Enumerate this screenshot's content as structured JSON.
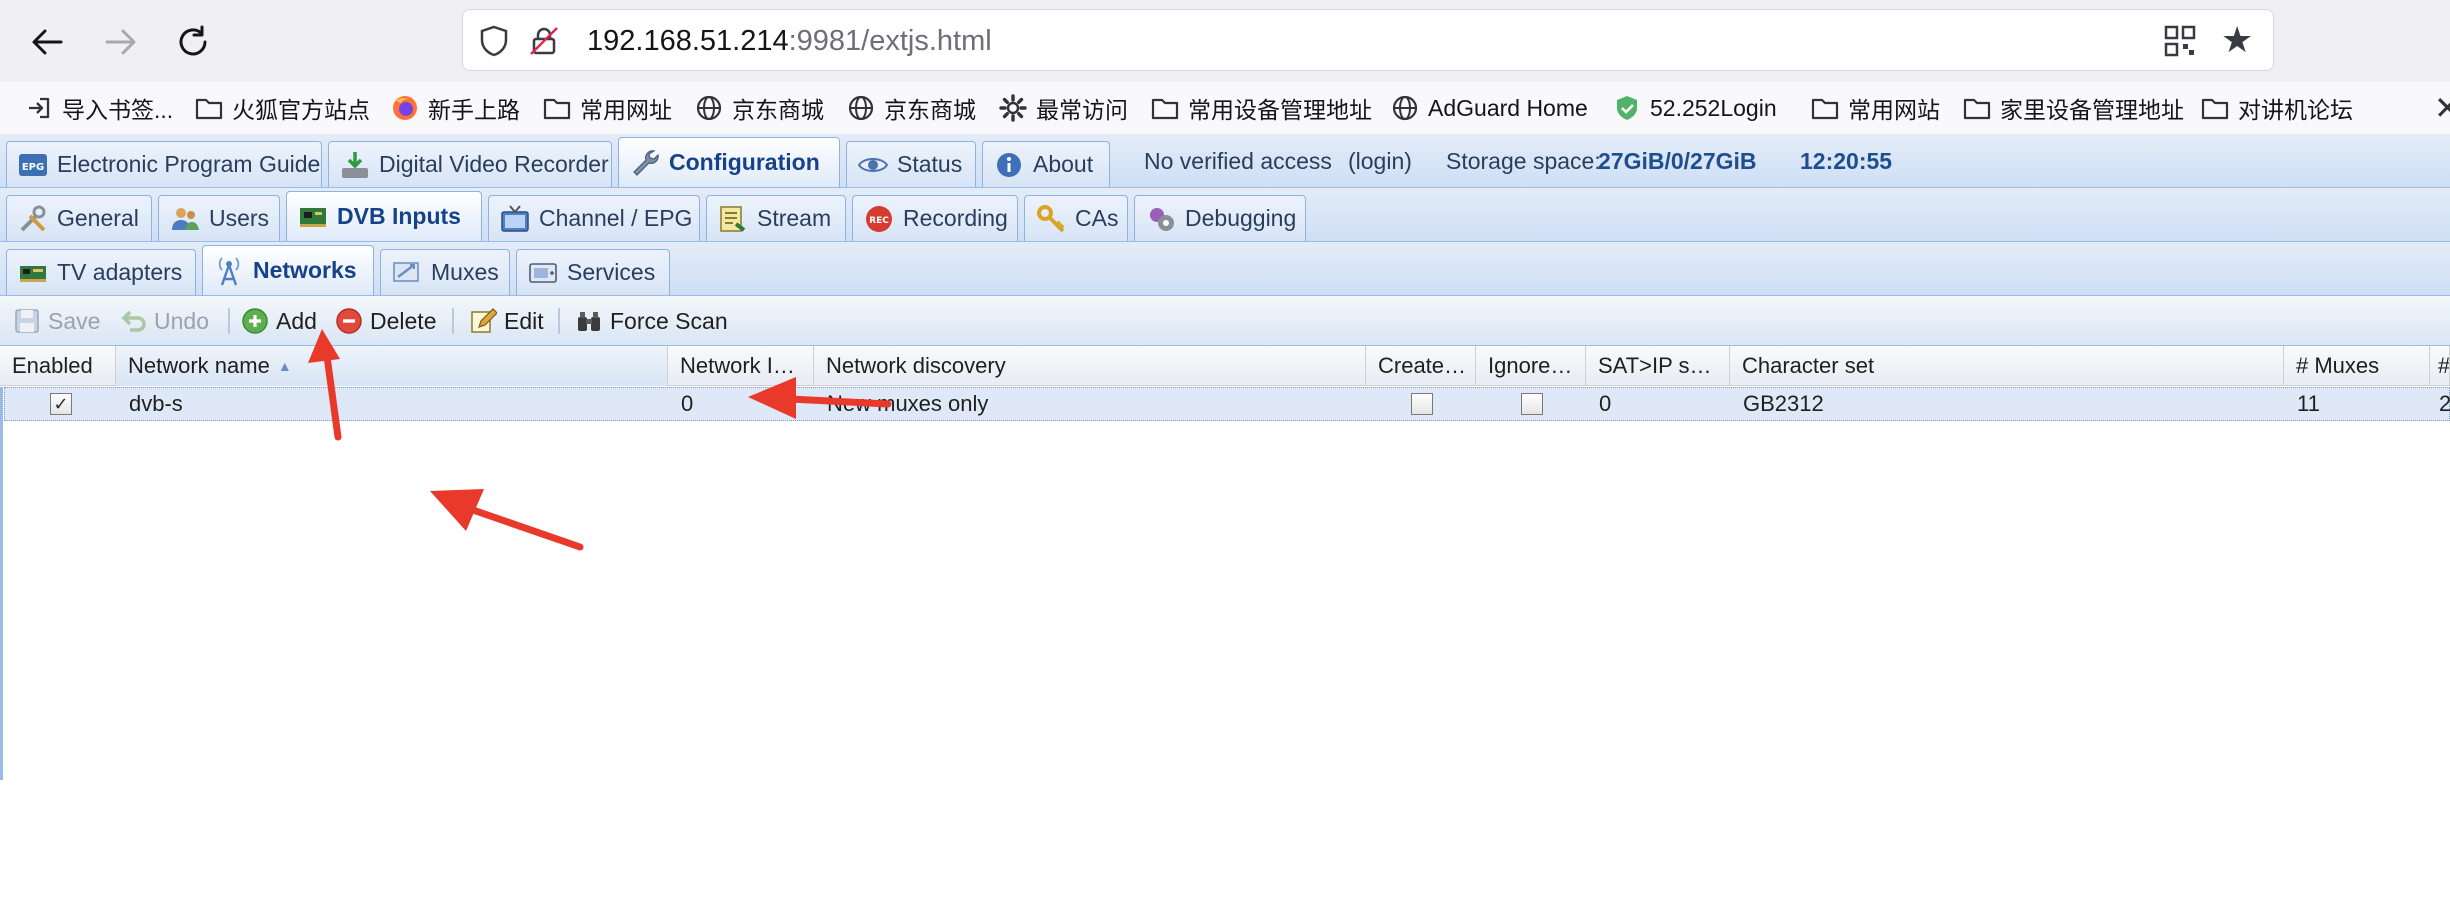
{
  "browser": {
    "url_host": "192.168.51.214",
    "url_rest": ":9981/extjs.html",
    "bookmarks": [
      {
        "label": "导入书签...",
        "icon": "import-icon"
      },
      {
        "label": "火狐官方站点",
        "icon": "folder-icon"
      },
      {
        "label": "新手上路",
        "icon": "firefox-icon"
      },
      {
        "label": "常用网址",
        "icon": "folder-icon"
      },
      {
        "label": "京东商城",
        "icon": "globe-icon"
      },
      {
        "label": "京东商城",
        "icon": "globe-icon"
      },
      {
        "label": "最常访问",
        "icon": "gear-icon"
      },
      {
        "label": "常用设备管理地址",
        "icon": "folder-icon"
      },
      {
        "label": "AdGuard Home",
        "icon": "globe-icon"
      },
      {
        "label": "52.252Login",
        "icon": "shield-check-icon"
      },
      {
        "label": "常用网站",
        "icon": "folder-icon"
      },
      {
        "label": "家里设备管理地址",
        "icon": "folder-icon"
      },
      {
        "label": "对讲机论坛",
        "icon": "folder-icon"
      }
    ]
  },
  "top_tabs": [
    {
      "label": "Electronic Program Guide",
      "icon": "epg-icon"
    },
    {
      "label": "Digital Video Recorder",
      "icon": "download-icon"
    },
    {
      "label": "Configuration",
      "icon": "wrench-icon",
      "active": true
    },
    {
      "label": "Status",
      "icon": "eye-icon"
    },
    {
      "label": "About",
      "icon": "info-icon"
    }
  ],
  "header_info": {
    "access": "No verified access",
    "login": "(login)",
    "storage_label": "Storage space:",
    "storage_value": "27GiB/0/27GiB",
    "time": "12:20:55"
  },
  "config_tabs": [
    {
      "label": "General",
      "icon": "tools-icon"
    },
    {
      "label": "Users",
      "icon": "users-icon"
    },
    {
      "label": "DVB Inputs",
      "icon": "card-icon",
      "active": true
    },
    {
      "label": "Channel / EPG",
      "icon": "tv-icon"
    },
    {
      "label": "Stream",
      "icon": "stream-icon"
    },
    {
      "label": "Recording",
      "icon": "rec-icon"
    },
    {
      "label": "CAs",
      "icon": "key-icon"
    },
    {
      "label": "Debugging",
      "icon": "debug-icon"
    }
  ],
  "dvb_tabs": [
    {
      "label": "TV adapters",
      "icon": "adapter-icon"
    },
    {
      "label": "Networks",
      "icon": "antenna-icon",
      "active": true
    },
    {
      "label": "Muxes",
      "icon": "mux-icon"
    },
    {
      "label": "Services",
      "icon": "services-icon"
    }
  ],
  "toolbar": {
    "save": "Save",
    "undo": "Undo",
    "add": "Add",
    "delete": "Delete",
    "edit": "Edit",
    "force_scan": "Force Scan"
  },
  "grid": {
    "columns": [
      "Enabled",
      "Network name",
      "Network I…",
      "Network discovery",
      "Create…",
      "Ignore…",
      "SAT>IP s…",
      "Character set",
      "# Muxes",
      "#"
    ],
    "rows": [
      {
        "enabled": true,
        "name": "dvb-s",
        "network_id": "0",
        "discovery": "New muxes only",
        "create": false,
        "ignore": false,
        "satip": "0",
        "charset": "GB2312",
        "muxes": "11",
        "extra": "2"
      }
    ]
  },
  "colors": {
    "annotation_arrow": "#e8392b",
    "tab_text_active": "#15428b",
    "tabbar_border": "#99bbe8",
    "row_selected": "#dfe8f6"
  }
}
